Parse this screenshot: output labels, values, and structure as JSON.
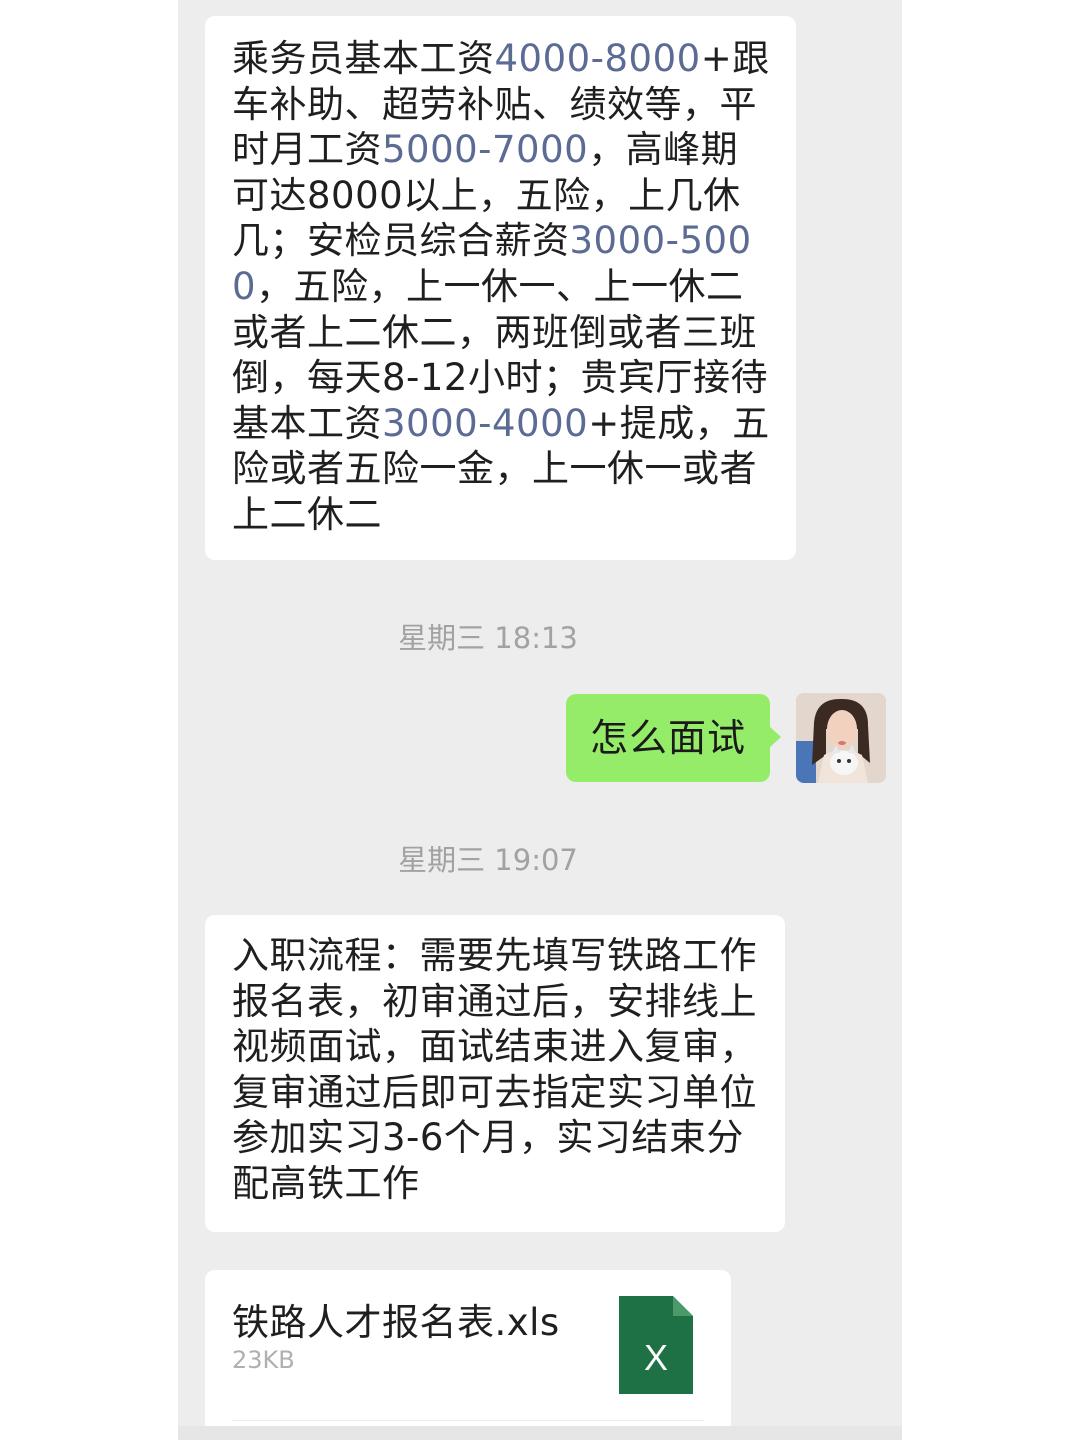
{
  "messages": {
    "first": {
      "segments": [
        {
          "text": "乘务员基本工资"
        },
        {
          "text": "4000-8000",
          "accent": true
        },
        {
          "text": "+跟车补助、超劳补贴、绩效等，平时月工资"
        },
        {
          "text": "5000-7000",
          "accent": true
        },
        {
          "text": "，高峰期可达8000以上，五险，上几休几；安检员综合薪资"
        },
        {
          "text": "3000-5000",
          "accent": true
        },
        {
          "text": "，五险，上一休一、上一休二或者上二休二，两班倒或者三班倒，每天8-12小时；贵宾厅接待基本工资"
        },
        {
          "text": "3000-4000",
          "accent": true
        },
        {
          "text": "+提成，五险或者五险一金，上一休一或者上二休二"
        }
      ]
    },
    "timestamp1": "星期三 18:13",
    "sent": "怎么面试",
    "timestamp2": "星期三 19:07",
    "second": "入职流程：需要先填写铁路工作报名表，初审通过后，安排线上视频面试，面试结束进入复审，复审通过后即可去指定实习单位参加实习3-6个月，实习结束分配高铁工作",
    "file": {
      "name": "铁路人才报名表.xls",
      "size": "23KB",
      "icon_letter": "X",
      "icon": "excel-file-icon"
    }
  },
  "colors": {
    "chat_background": "#ededed",
    "sent_bubble": "#95ec69",
    "accent_number": "#5b6b93",
    "excel_green": "#1e7145"
  }
}
